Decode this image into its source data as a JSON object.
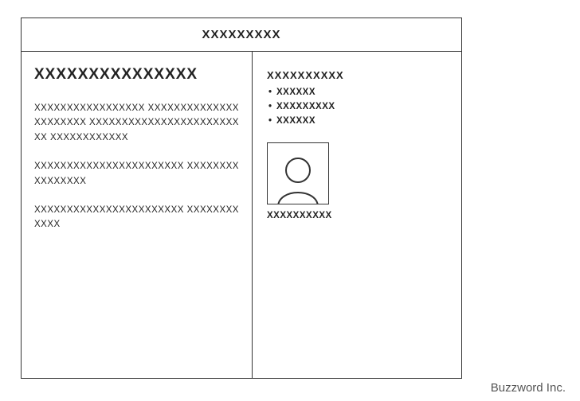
{
  "header": {
    "title": "XXXXXXXXX"
  },
  "main": {
    "heading": "XXXXXXXXXXXXXXX",
    "p1": "XXXXXXXXXXXXXXXXX XXXXXXXXXXXXXXXXXXXXXX XXXXXXXXXXXXXXXXXXXXXXXXX XXXXXXXXXXXX",
    "p2": "XXXXXXXXXXXXXXXXXXXXXXX XXXXXXXXXXXXXXXX",
    "p3": "XXXXXXXXXXXXXXXXXXXXXXX XXXXXXXXXXXX"
  },
  "sidebar": {
    "title": "XXXXXXXXXX",
    "items": [
      "XXXXXX",
      "XXXXXXXXX",
      "XXXXXX"
    ],
    "caption": "XXXXXXXXXX"
  },
  "footer": {
    "brand": "Buzzword Inc."
  }
}
